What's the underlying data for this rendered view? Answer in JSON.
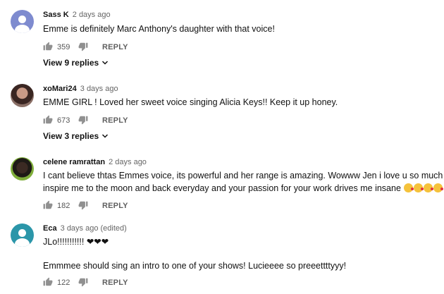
{
  "comments": [
    {
      "author": "Sass K",
      "time": "2 days ago",
      "lines": [
        "Emme is definitely Marc Anthony's daughter with that voice!"
      ],
      "likes": "359",
      "reply_label": "REPLY",
      "view_replies": "View 9 replies",
      "avatar": "generic-person-avatar"
    },
    {
      "author": "xoMari24",
      "time": "3 days ago",
      "lines": [
        "EMME GIRL ! Loved her sweet voice singing Alicia Keys!! Keep it up honey."
      ],
      "likes": "673",
      "reply_label": "REPLY",
      "view_replies": "View 3 replies",
      "avatar": "profile-photo-avatar"
    },
    {
      "author": "celene ramrattan",
      "time": "2 days ago",
      "lines": [
        "I cant believe thtas Emmes voice, its powerful and her range is amazing. Wowww Jen i love u so much u",
        "inspire me to the moon and back everyday and your passion for your work drives me insane"
      ],
      "emoji": [
        "kiss-emoji",
        "kiss-emoji",
        "kiss-emoji",
        "kiss-emoji"
      ],
      "likes": "182",
      "reply_label": "REPLY",
      "avatar": "profile-photo-avatar"
    },
    {
      "author": "Eca",
      "time": "3 days ago (edited)",
      "lines": [
        "JLo!!!!!!!!!!! ❤❤❤",
        "",
        "Emmmee should sing an intro to one of your shows! Lucieeee so preeettttyyy!"
      ],
      "likes": "122",
      "reply_label": "REPLY",
      "avatar": "generic-person-avatar"
    }
  ],
  "colors": {
    "text": "#111111",
    "muted": "#606060",
    "avatar_blue": "#7e8bcf",
    "avatar_teal": "#2b96a9"
  }
}
